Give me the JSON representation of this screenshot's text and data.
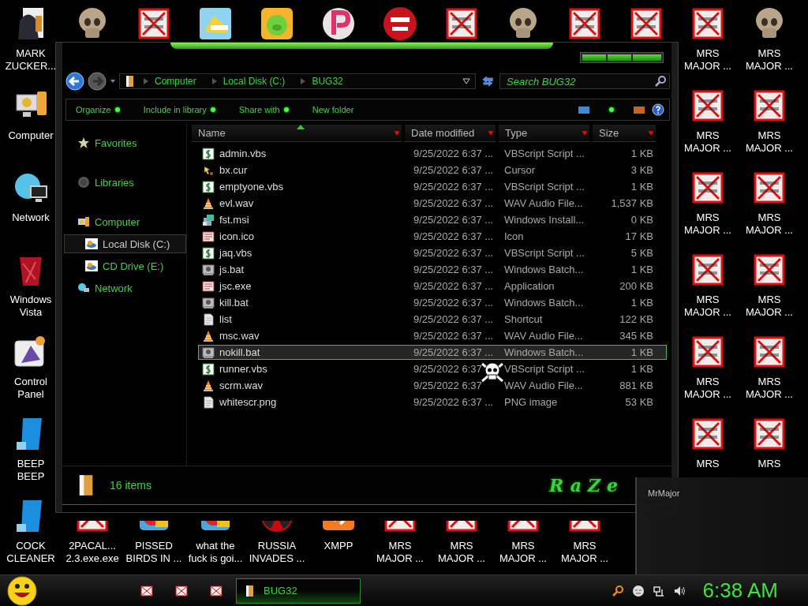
{
  "desktop": {
    "left_column": [
      {
        "label": "MARK\nZUCKER...",
        "kind": "person-folder"
      },
      {
        "label": "Computer",
        "kind": "computer"
      },
      {
        "label": "Network",
        "kind": "globe"
      },
      {
        "label": "Windows\nVista",
        "kind": "trash"
      },
      {
        "label": "Control\nPanel",
        "kind": "control-panel"
      },
      {
        "label": "BEEP\nBEEP",
        "kind": "blue-app"
      },
      {
        "label": "COCK\nCLEANER",
        "kind": "blue-app"
      }
    ],
    "top_row": [
      {
        "kind": "skull"
      },
      {
        "kind": "denied"
      },
      {
        "kind": "yellow-app"
      },
      {
        "kind": "pig"
      },
      {
        "kind": "p-logo"
      },
      {
        "kind": "dev"
      },
      {
        "kind": "denied"
      },
      {
        "kind": "skull"
      },
      {
        "kind": "denied"
      },
      {
        "kind": "denied"
      }
    ],
    "right_columns": [
      [
        {
          "label": "MRS\nMAJOR ...",
          "kind": "denied"
        },
        {
          "label": "MRS\nMAJOR ...",
          "kind": "denied"
        },
        {
          "label": "MRS\nMAJOR ...",
          "kind": "denied"
        },
        {
          "label": "MRS\nMAJOR ...",
          "kind": "denied"
        },
        {
          "label": "MRS\nMAJOR ...",
          "kind": "denied"
        },
        {
          "label": "MRS",
          "kind": "denied"
        }
      ],
      [
        {
          "label": "MRS\nMAJOR ...",
          "kind": "skull"
        },
        {
          "label": "MRS\nMAJOR ...",
          "kind": "denied"
        },
        {
          "label": "MRS\nMAJOR ...",
          "kind": "denied"
        },
        {
          "label": "MRS\nMAJOR ...",
          "kind": "denied"
        },
        {
          "label": "MRS\nMAJOR ...",
          "kind": "denied"
        },
        {
          "label": "MRS",
          "kind": "denied"
        }
      ]
    ],
    "bottom_row": [
      {
        "label": "2PACAL...\n2.3.exe.exe",
        "kind": "denied"
      },
      {
        "label": "PISSED\nBIRDS IN ...",
        "kind": "birds"
      },
      {
        "label": "what the\nfuck is goi...",
        "kind": "birds"
      },
      {
        "label": "RUSSIA\nINVADES ...",
        "kind": "radiation"
      },
      {
        "label": "XMPP",
        "kind": "xampp"
      },
      {
        "label": "MRS\nMAJOR ...",
        "kind": "denied"
      },
      {
        "label": "MRS\nMAJOR ...",
        "kind": "denied"
      },
      {
        "label": "MRS\nMAJOR ...",
        "kind": "denied"
      },
      {
        "label": "MRS\nMAJOR ...",
        "kind": "denied"
      }
    ]
  },
  "window": {
    "breadcrumbs": [
      "Computer",
      "Local Disk (C:)",
      "BUG32"
    ],
    "search": {
      "placeholder": "Search BUG32"
    },
    "toolbar": [
      {
        "label": "Organize",
        "has_menu": true
      },
      {
        "label": "Include in library",
        "has_menu": true
      },
      {
        "label": "Share with",
        "has_menu": true
      },
      {
        "label": "New folder",
        "has_menu": false
      }
    ],
    "nav_pane": [
      {
        "label": "Favorites",
        "kind": "star",
        "selected": false
      },
      {
        "label": "Libraries",
        "kind": "library",
        "selected": false
      },
      {
        "label": "Computer",
        "kind": "computer",
        "selected": false,
        "children": [
          {
            "label": "Local Disk (C:)",
            "kind": "drive",
            "selected": true
          },
          {
            "label": "CD Drive (E:)",
            "kind": "drive",
            "selected": false
          }
        ]
      },
      {
        "label": "Network",
        "kind": "network",
        "selected": false
      }
    ],
    "columns": [
      {
        "label": "Name",
        "sorted": true
      },
      {
        "label": "Date modified",
        "sorted": false
      },
      {
        "label": "Type",
        "sorted": false
      },
      {
        "label": "Size",
        "sorted": false
      }
    ],
    "files": [
      {
        "name": "admin.vbs",
        "date": "9/25/2022 6:37 ...",
        "type": "VBScript Script ...",
        "size": "1 KB",
        "kind": "script",
        "selected": false
      },
      {
        "name": "bx.cur",
        "date": "9/25/2022 6:37 ...",
        "type": "Cursor",
        "size": "3 KB",
        "kind": "cursor",
        "selected": false
      },
      {
        "name": "emptyone.vbs",
        "date": "9/25/2022 6:37 ...",
        "type": "VBScript Script ...",
        "size": "1 KB",
        "kind": "script",
        "selected": false
      },
      {
        "name": "evl.wav",
        "date": "9/25/2022 6:37 ...",
        "type": "WAV Audio File...",
        "size": "1,537 KB",
        "kind": "audio",
        "selected": false
      },
      {
        "name": "fst.msi",
        "date": "9/25/2022 6:37 ...",
        "type": "Windows Install...",
        "size": "0 KB",
        "kind": "installer",
        "selected": false
      },
      {
        "name": "icon.ico",
        "date": "9/25/2022 6:37 ...",
        "type": "Icon",
        "size": "17 KB",
        "kind": "image",
        "selected": false
      },
      {
        "name": "jaq.vbs",
        "date": "9/25/2022 6:37 ...",
        "type": "VBScript Script ...",
        "size": "5 KB",
        "kind": "script",
        "selected": false
      },
      {
        "name": "js.bat",
        "date": "9/25/2022 6:37 ...",
        "type": "Windows Batch...",
        "size": "1 KB",
        "kind": "batch",
        "selected": false
      },
      {
        "name": "jsc.exe",
        "date": "9/25/2022 6:37 ...",
        "type": "Application",
        "size": "200 KB",
        "kind": "image",
        "selected": false
      },
      {
        "name": "kill.bat",
        "date": "9/25/2022 6:37 ...",
        "type": "Windows Batch...",
        "size": "1 KB",
        "kind": "batch",
        "selected": false
      },
      {
        "name": "list",
        "date": "9/25/2022 6:37 ...",
        "type": "Shortcut",
        "size": "122 KB",
        "kind": "document",
        "selected": false
      },
      {
        "name": "msc.wav",
        "date": "9/25/2022 6:37 ...",
        "type": "WAV Audio File...",
        "size": "345 KB",
        "kind": "audio",
        "selected": false
      },
      {
        "name": "nokill.bat",
        "date": "9/25/2022 6:37 ...",
        "type": "Windows Batch...",
        "size": "1 KB",
        "kind": "batch",
        "selected": true
      },
      {
        "name": "runner.vbs",
        "date": "9/25/2022 6:37",
        "type": "VBScript Script ...",
        "size": "1 KB",
        "kind": "script",
        "selected": false
      },
      {
        "name": "scrm.wav",
        "date": "9/25/2022 6:37",
        "type": "WAV Audio File...",
        "size": "881 KB",
        "kind": "audio",
        "selected": false
      },
      {
        "name": "whitescr.png",
        "date": "9/25/2022 6:37 ...",
        "type": "PNG image",
        "size": "53 KB",
        "kind": "document",
        "selected": false
      }
    ],
    "status": "16 items",
    "logo": "RaZe"
  },
  "preview": {
    "title": "MrMajor"
  },
  "taskbar": {
    "quick_launch": [
      {
        "kind": "denied"
      },
      {
        "kind": "denied"
      },
      {
        "kind": "denied"
      }
    ],
    "tasks": [
      {
        "label": "BUG32",
        "selected": true
      }
    ],
    "clock": "6:38 AM"
  }
}
